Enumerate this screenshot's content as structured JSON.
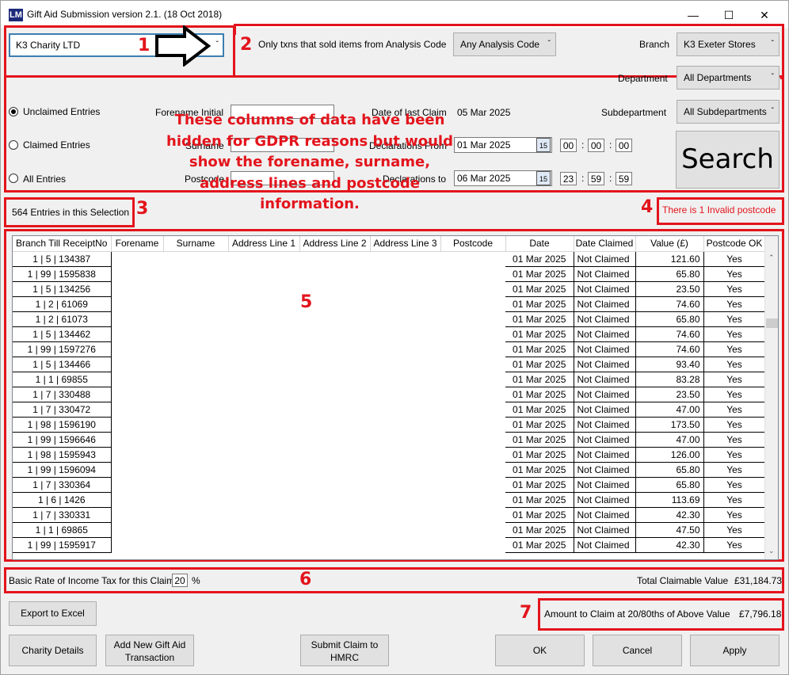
{
  "window": {
    "title": "Gift Aid Submission version 2.1. (18 Oct 2018)",
    "icon": "lm-logo-icon"
  },
  "annotations": {
    "n1": "1",
    "n2": "2",
    "n3": "3",
    "n4": "4",
    "n5": "5",
    "n6": "6",
    "n7": "7",
    "hidden_note": "These columns of data have been hidden for GDPR reasons but would show the forename, surname, address lines and postcode information."
  },
  "charity_select": {
    "value": "K3 Charity LTD"
  },
  "filters": {
    "only_txns_label": "Only txns that sold items from Analysis Code",
    "analysis_code": "Any Analysis Code",
    "branch_label": "Branch",
    "branch": "K3 Exeter Stores",
    "department_label": "Department",
    "department": "All Departments",
    "subdepartment_label": "Subdepartment",
    "subdepartment": "All Subdepartments",
    "radio_unclaimed": "Unclaimed Entries",
    "radio_claimed": "Claimed Entries",
    "radio_all": "All Entries",
    "forename_initial_label": "Forename Initial",
    "surname_label": "Surname",
    "postcode_label": "Postcode",
    "date_last_claim_label": "Date of last Claim",
    "date_last_claim": "05 Mar 2025",
    "decl_from_label": "Declarations From",
    "decl_from": "01 Mar 2025",
    "decl_from_h": "00",
    "decl_from_m": "00",
    "decl_from_s": "00",
    "decl_to_label": "Declarations to",
    "decl_to": "06 Mar 2025",
    "decl_to_h": "23",
    "decl_to_m": "59",
    "decl_to_s": "59",
    "search": "Search",
    "cal_day": "15",
    "colon": ":"
  },
  "entries_count": "564 Entries in this Selection",
  "invalid_postcode": "There is 1 Invalid postcode",
  "table": {
    "headers": [
      "Branch Till ReceiptNo",
      "Forename",
      "Surname",
      "Address Line 1",
      "Address Line 2",
      "Address Line 3",
      "Postcode",
      "Date",
      "Date Claimed",
      "Value (£)",
      "Postcode OK"
    ],
    "rows": [
      [
        "1 | 5 | 134387",
        "01 Mar 2025",
        "Not Claimed",
        "121.60",
        "Yes"
      ],
      [
        "1 | 99 | 1595838",
        "01 Mar 2025",
        "Not Claimed",
        "65.80",
        "Yes"
      ],
      [
        "1 | 5 | 134256",
        "01 Mar 2025",
        "Not Claimed",
        "23.50",
        "Yes"
      ],
      [
        "1 | 2 | 61069",
        "01 Mar 2025",
        "Not Claimed",
        "74.60",
        "Yes"
      ],
      [
        "1 | 2 | 61073",
        "01 Mar 2025",
        "Not Claimed",
        "65.80",
        "Yes"
      ],
      [
        "1 | 5 | 134462",
        "01 Mar 2025",
        "Not Claimed",
        "74.60",
        "Yes"
      ],
      [
        "1 | 99 | 1597276",
        "01 Mar 2025",
        "Not Claimed",
        "74.60",
        "Yes"
      ],
      [
        "1 | 5 | 134466",
        "01 Mar 2025",
        "Not Claimed",
        "93.40",
        "Yes"
      ],
      [
        "1 | 1 | 69855",
        "01 Mar 2025",
        "Not Claimed",
        "83.28",
        "Yes"
      ],
      [
        "1 | 7 | 330488",
        "01 Mar 2025",
        "Not Claimed",
        "23.50",
        "Yes"
      ],
      [
        "1 | 7 | 330472",
        "01 Mar 2025",
        "Not Claimed",
        "47.00",
        "Yes"
      ],
      [
        "1 | 98 | 1596190",
        "01 Mar 2025",
        "Not Claimed",
        "173.50",
        "Yes"
      ],
      [
        "1 | 99 | 1596646",
        "01 Mar 2025",
        "Not Claimed",
        "47.00",
        "Yes"
      ],
      [
        "1 | 98 | 1595943",
        "01 Mar 2025",
        "Not Claimed",
        "126.00",
        "Yes"
      ],
      [
        "1 | 99 | 1596094",
        "01 Mar 2025",
        "Not Claimed",
        "65.80",
        "Yes"
      ],
      [
        "1 | 7 | 330364",
        "01 Mar 2025",
        "Not Claimed",
        "65.80",
        "Yes"
      ],
      [
        "1 | 6 | 1426",
        "01 Mar 2025",
        "Not Claimed",
        "113.69",
        "Yes"
      ],
      [
        "1 | 7 | 330331",
        "01 Mar 2025",
        "Not Claimed",
        "42.30",
        "Yes"
      ],
      [
        "1 | 1 | 69865",
        "01 Mar 2025",
        "Not Claimed",
        "47.50",
        "Yes"
      ],
      [
        "1 | 99 | 1595917",
        "01 Mar 2025",
        "Not Claimed",
        "42.30",
        "Yes"
      ]
    ]
  },
  "tax": {
    "label": "Basic Rate of Income Tax for this Claim",
    "rate": "20",
    "pct": "%",
    "total_label": "Total Claimable Value",
    "total": "£31,184.73"
  },
  "claim": {
    "label": "Amount to Claim at 20/80ths of Above Value",
    "value": "£7,796.18"
  },
  "buttons": {
    "export": "Export to Excel",
    "charity_details": "Charity Details",
    "add_new_line1": "Add New Gift Aid",
    "add_new_line2": "Transaction",
    "submit_line1": "Submit Claim to",
    "submit_line2": "HMRC",
    "ok": "OK",
    "cancel": "Cancel",
    "apply": "Apply"
  }
}
